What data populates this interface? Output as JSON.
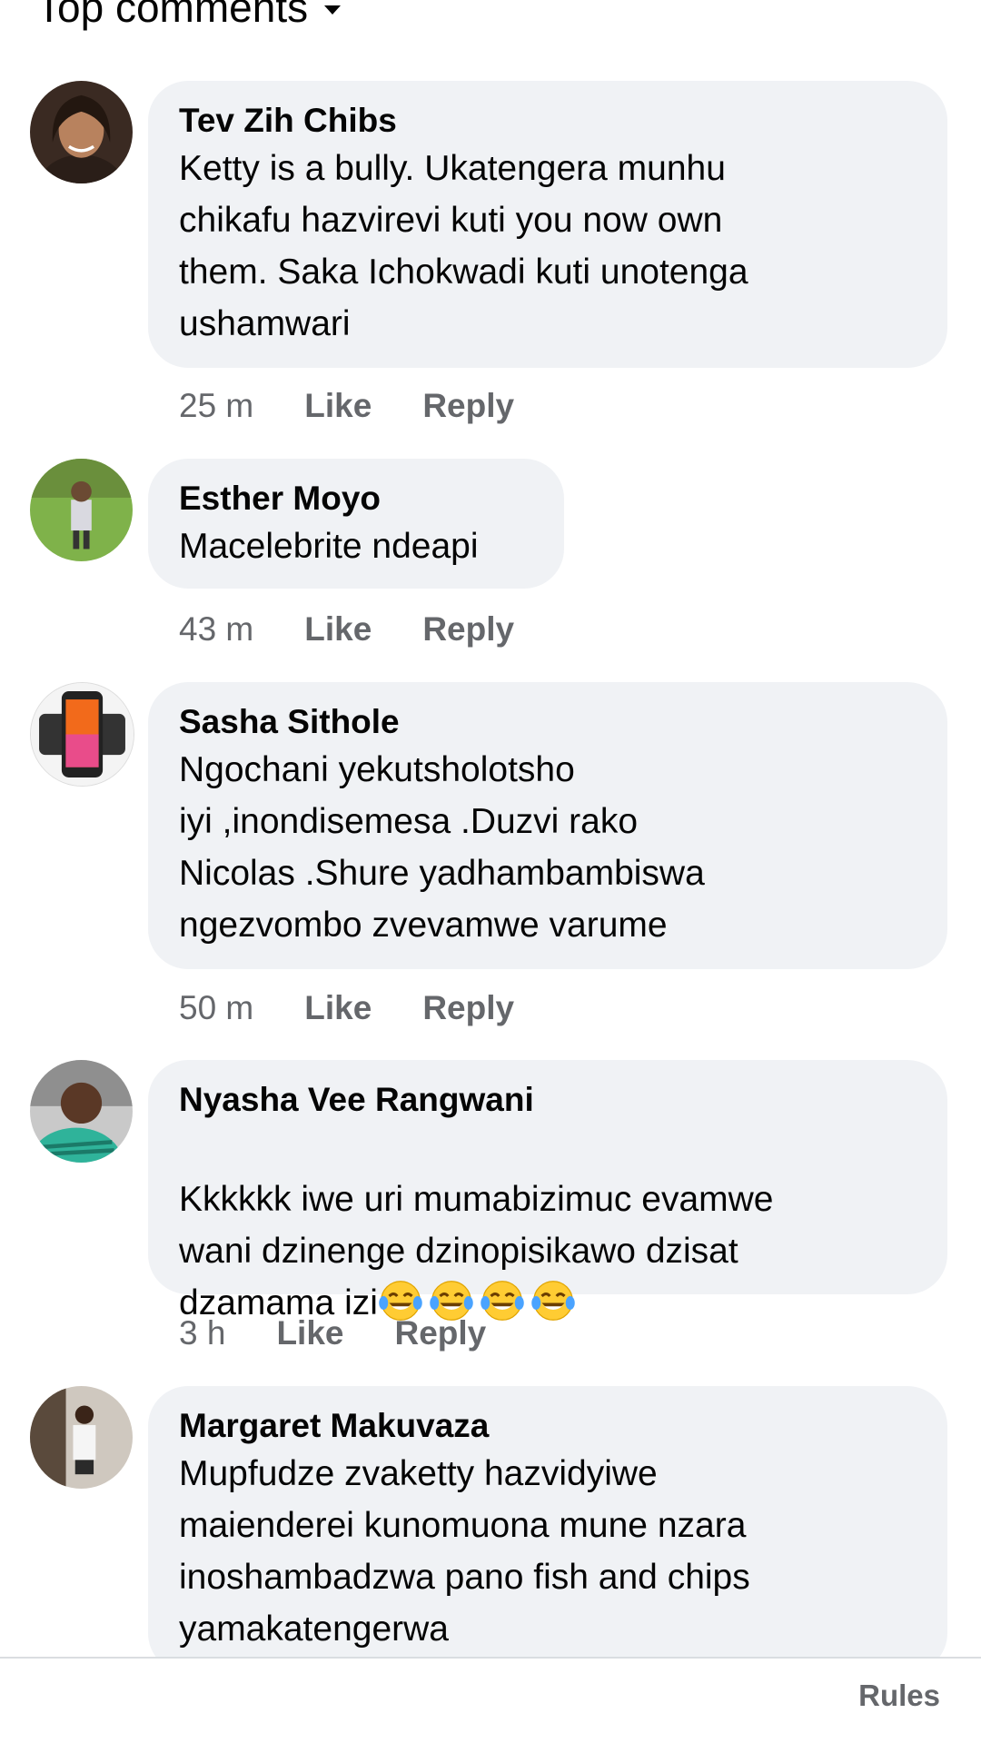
{
  "header": {
    "sort_label": "Top comments"
  },
  "comments": [
    {
      "author": "Tev Zih Chibs",
      "text": "Ketty is a bully. Ukatengera munhu\nchikafu hazvirevi kuti you now own\nthem. Saka Ichokwadi kuti unotenga\nushamwari",
      "time": "25 m",
      "like": "Like",
      "reply": "Reply"
    },
    {
      "author": "Esther Moyo",
      "text": "Macelebrite ndeapi",
      "time": "43 m",
      "like": "Like",
      "reply": "Reply"
    },
    {
      "author": "Sasha Sithole",
      "text": "Ngochani yekutsholotsho\niyi ,inondisemesa .Duzvi rako\nNicolas .Shure yadhambambiswa\nngezvombo zvevamwe varume",
      "time": "50 m",
      "like": "Like",
      "reply": "Reply"
    },
    {
      "author": "Nyasha Vee Rangwani",
      "text": "Kkkkkk iwe uri mumabizimuc evamwe\nwani dzinenge dzinopisikawo dzisat\ndzamama izi",
      "emoji_count": 4,
      "emoji_name": "tears-of-joy-emoji",
      "time": "3 h",
      "like": "Like",
      "reply": "Reply"
    },
    {
      "author": "Margaret Makuvaza",
      "text": "Mupfudze zvaketty hazvidyiwe\nmaienderei kunomuona mune nzara\ninoshambadzwa pano fish and chips\nyamakatengerwa"
    }
  ],
  "footer": {
    "rules_label": "Rules"
  },
  "colors": {
    "bubble": "#f0f2f5",
    "meta_text": "#65676b",
    "primary_text": "#050505"
  }
}
